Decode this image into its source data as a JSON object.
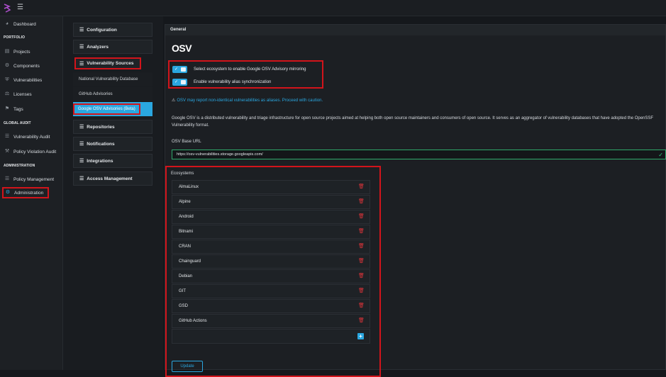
{
  "sidebar": {
    "items": [
      {
        "label": "Dashboard",
        "icon": "dashboard-icon"
      },
      {
        "section": "PORTFOLIO"
      },
      {
        "label": "Projects",
        "icon": "chart-icon"
      },
      {
        "label": "Components",
        "icon": "components-icon"
      },
      {
        "label": "Vulnerabilities",
        "icon": "shield-icon"
      },
      {
        "label": "Licenses",
        "icon": "balance-icon"
      },
      {
        "label": "Tags",
        "icon": "tag-icon"
      },
      {
        "section": "GLOBAL AUDIT"
      },
      {
        "label": "Vulnerability Audit",
        "icon": "list-icon"
      },
      {
        "label": "Policy Violation Audit",
        "icon": "gavel-icon"
      },
      {
        "section": "ADMINISTRATION"
      },
      {
        "label": "Policy Management",
        "icon": "list-icon"
      },
      {
        "label": "Administration",
        "icon": "cogs-icon",
        "active": true
      }
    ]
  },
  "submenu": {
    "configuration": "Configuration",
    "analyzers": "Analyzers",
    "vulnerability_sources": "Vulnerability Sources",
    "nvd": "National Vulnerability Database",
    "github": "GitHub Advisories",
    "google_osv": "Google OSV Advisories (Beta)",
    "repositories": "Repositories",
    "notifications": "Notifications",
    "integrations": "Integrations",
    "access_management": "Access Management"
  },
  "card": {
    "header": "General",
    "logo_text": "OSV",
    "toggle1_label": "Select ecosystem to enable Google OSV Advisory mirroring",
    "toggle2_label": "Enable vulnerability alias synchronization",
    "warning": "OSV may report non-identical vulnerabilities as aliases. Proceed with caution.",
    "description": "Google OSV is a distributed vulnerability and triage infrastructure for open source projects aimed at helping both open source maintainers and consumers of open source. It serves as an aggregator of vulnerability databases that have adopted the OpenSSF Vulnerability format.",
    "url_label": "OSV Base URL",
    "url_value": "https://osv-vulnerabilities.storage.googleapis.com/",
    "ecosystems_label": "Ecosystems",
    "ecosystems": [
      "AlmaLinux",
      "Alpine",
      "Android",
      "Bitnami",
      "CRAN",
      "Chainguard",
      "Debian",
      "GIT",
      "GSD",
      "GitHub Actions"
    ],
    "update_button": "Update"
  },
  "colors": {
    "accent": "#2aa7e0",
    "highlight": "#d2141b",
    "delete": "#e0343a",
    "valid": "#2fa86b"
  }
}
